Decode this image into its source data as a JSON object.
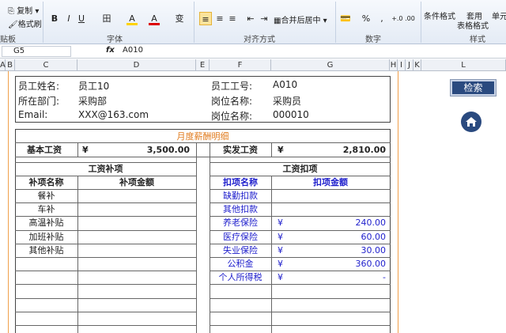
{
  "ribbon": {
    "paste_copy": "复制",
    "format_painter": "格式刷",
    "clipboard_label": "贴板",
    "font_label": "字体",
    "align_label": "对齐方式",
    "number_label": "数字",
    "style_label": "样式",
    "bold": "B",
    "italic": "I",
    "underline": "U",
    "border": "田",
    "fill": "A",
    "fontcolor": "A",
    "wen": "变",
    "merge_label": "合并后居中",
    "percent": "%",
    "comma": ",",
    "inc_dec": "+.0 .00",
    "cond_format": "条件格式",
    "table_format": "套用",
    "table_format2": "表格格式",
    "cell_style": "单元"
  },
  "formula_bar": {
    "name_box": "G5",
    "fx": "fx",
    "value": "A010"
  },
  "columns": [
    "A",
    "B",
    "C",
    "D",
    "E",
    "F",
    "G",
    "H",
    "I",
    "J",
    "K",
    "L"
  ],
  "employee": {
    "name_label": "员工姓名:",
    "name_value": "员工10",
    "id_label": "员工工号:",
    "id_value": "A010",
    "dept_label": "所在部门:",
    "dept_value": "采购部",
    "post_label": "岗位名称:",
    "post_value": "采购员",
    "email_label": "Email:",
    "email_value": "XXX@163.com",
    "post2_label": "岗位名称:",
    "post2_value": "000010"
  },
  "salary": {
    "title": "月度薪酬明细",
    "base_label": "基本工资",
    "base_cur": "¥",
    "base_value": "3,500.00",
    "net_label": "实发工资",
    "net_cur": "¥",
    "net_value": "2,810.00",
    "allowance_title": "工资补项",
    "allowance_name_hdr": "补项名称",
    "allowance_amt_hdr": "补项金额",
    "allowances": [
      "餐补",
      "车补",
      "高温补贴",
      "加班补贴",
      "其他补贴"
    ],
    "deduct_title": "工资扣项",
    "deduct_name_hdr": "扣项名称",
    "deduct_amt_hdr": "扣项金额",
    "deductions": [
      {
        "name": "缺勤扣款",
        "cur": "",
        "amt": ""
      },
      {
        "name": "其他扣款",
        "cur": "",
        "amt": ""
      },
      {
        "name": "养老保险",
        "cur": "¥",
        "amt": "240.00"
      },
      {
        "name": "医疗保险",
        "cur": "¥",
        "amt": "60.00"
      },
      {
        "name": "失业保险",
        "cur": "¥",
        "amt": "30.00"
      },
      {
        "name": "公积金",
        "cur": "¥",
        "amt": "360.00"
      },
      {
        "name": "个人所得税",
        "cur": "¥",
        "amt": "-"
      }
    ]
  },
  "side": {
    "search_button": "检索",
    "home_icon": "home-icon"
  },
  "colors": {
    "accent": "#2a4a7f",
    "orange": "#e07b1e",
    "blue_text": "#1e1ecc"
  }
}
